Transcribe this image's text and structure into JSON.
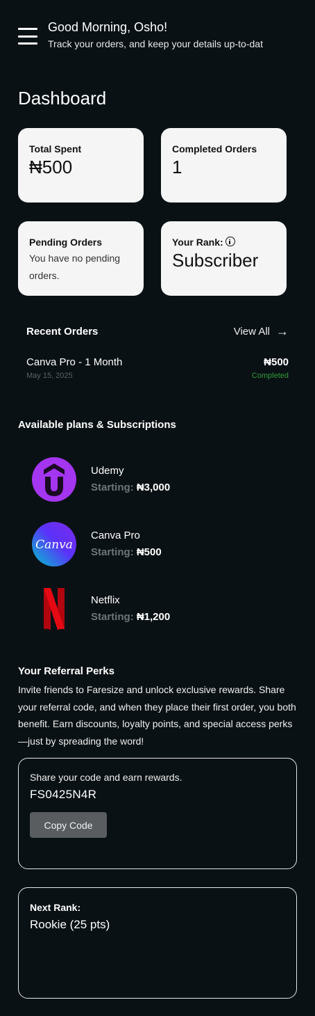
{
  "header": {
    "greeting": "Good Morning, Osho!",
    "subtitle": "Track your orders, and keep your details up-to-dat"
  },
  "dashboard": {
    "title": "Dashboard",
    "cards": {
      "total_spent": {
        "label": "Total Spent",
        "value": "₦500"
      },
      "completed_orders": {
        "label": "Completed Orders",
        "value": "1"
      },
      "pending_orders": {
        "label": "Pending Orders",
        "text": "You have no pending orders."
      },
      "rank": {
        "label": "Your Rank:",
        "value": "Subscriber"
      }
    }
  },
  "recent_orders": {
    "title": "Recent Orders",
    "view_all": "View All",
    "orders": [
      {
        "name": "Canva Pro - 1 Month",
        "date": "May 15, 2025",
        "price": "₦500",
        "status": "Completed"
      }
    ]
  },
  "plans": {
    "title": "Available plans & Subscriptions",
    "starting_label": "Starting:",
    "items": [
      {
        "name": "Udemy",
        "price": "₦3,000",
        "icon": "udemy-logo-icon"
      },
      {
        "name": "Canva Pro",
        "price": "₦500",
        "icon": "canva-logo-icon",
        "logo_text": "Canva"
      },
      {
        "name": "Netflix",
        "price": "₦1,200",
        "icon": "netflix-logo-icon"
      }
    ]
  },
  "referral": {
    "title": "Your Referral Perks",
    "description": "Invite friends to Faresize and unlock exclusive rewards. Share your referral code, and when they place their first order, you both benefit. Earn discounts, loyalty points, and special access perks—just by spreading the word!",
    "share_text": "Share your code and earn rewards.",
    "code": "FS0425N4R",
    "copy_button": "Copy Code"
  },
  "next_rank": {
    "label": "Next Rank:",
    "value": "Rookie (25 pts)"
  },
  "colors": {
    "background": "#0a1114",
    "card": "#f5f5f5",
    "completed": "#2d9a3a",
    "udemy": "#a435f0",
    "netflix": "#b1060f"
  }
}
